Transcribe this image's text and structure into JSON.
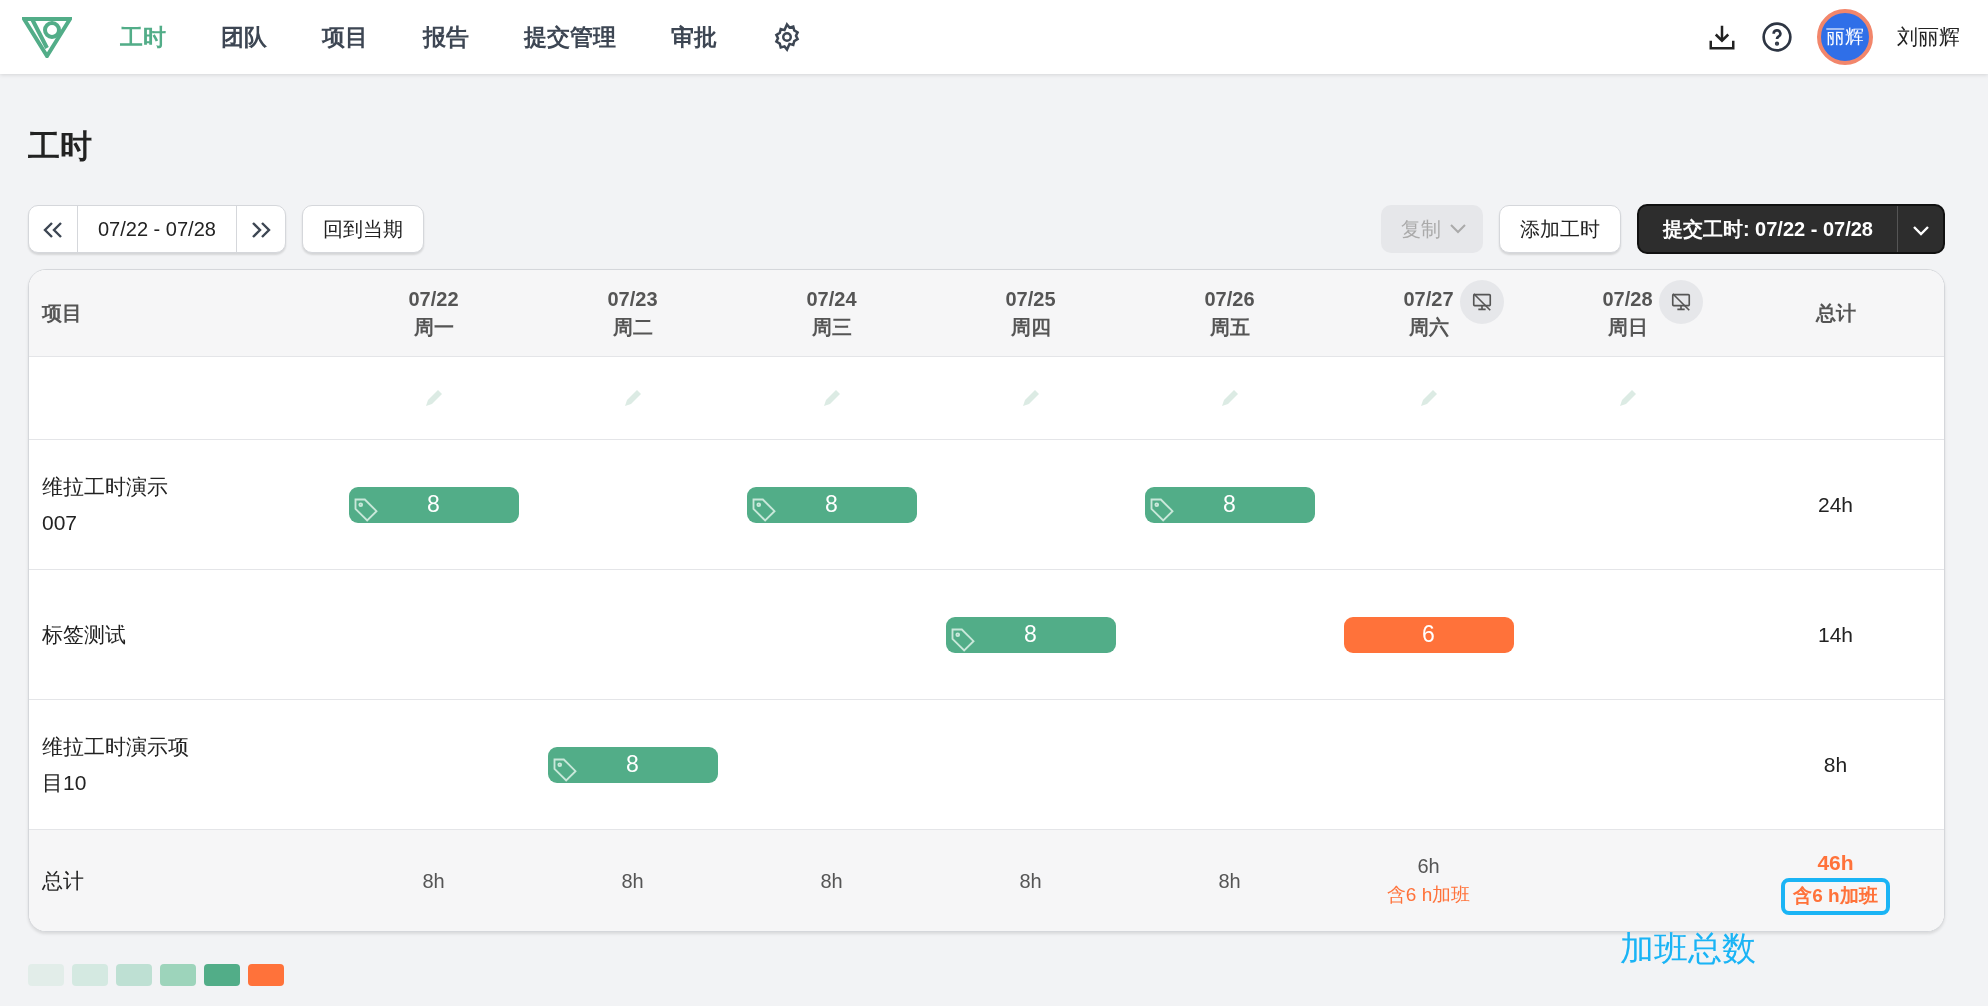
{
  "nav": {
    "items": [
      {
        "label": "工时",
        "selected": true
      },
      {
        "label": "团队",
        "selected": false
      },
      {
        "label": "项目",
        "selected": false
      },
      {
        "label": "报告",
        "selected": false
      },
      {
        "label": "提交管理",
        "selected": false
      },
      {
        "label": "审批",
        "selected": false
      }
    ],
    "user": {
      "avatar_text": "丽辉",
      "name": "刘丽辉"
    }
  },
  "page_title": "工时",
  "toolbar": {
    "range": "07/22 - 07/28",
    "current_button": "回到当期",
    "copy": {
      "label": "复制",
      "disabled": true
    },
    "add_button": "添加工时",
    "submit_button": "提交工时: 07/22 - 07/28"
  },
  "table": {
    "project_header": "项目",
    "total_header": "总计",
    "days": [
      {
        "date": "07/22",
        "weekday": "周一",
        "off_day": false
      },
      {
        "date": "07/23",
        "weekday": "周二",
        "off_day": false
      },
      {
        "date": "07/24",
        "weekday": "周三",
        "off_day": false
      },
      {
        "date": "07/25",
        "weekday": "周四",
        "off_day": false
      },
      {
        "date": "07/26",
        "weekday": "周五",
        "off_day": false
      },
      {
        "date": "07/27",
        "weekday": "周六",
        "off_day": true
      },
      {
        "date": "07/28",
        "weekday": "周日",
        "off_day": true
      }
    ],
    "rows": [
      {
        "project": "维拉工时演示007",
        "total": "24h",
        "cells": [
          {
            "hours": "8",
            "tagged": true,
            "overtime": false
          },
          null,
          {
            "hours": "8",
            "tagged": true,
            "overtime": false
          },
          null,
          {
            "hours": "8",
            "tagged": true,
            "overtime": false
          },
          null,
          null
        ]
      },
      {
        "project": "标签测试",
        "total": "14h",
        "cells": [
          null,
          null,
          null,
          {
            "hours": "8",
            "tagged": true,
            "overtime": false
          },
          null,
          {
            "hours": "6",
            "tagged": false,
            "overtime": true
          },
          null
        ]
      },
      {
        "project": "维拉工时演示项目10",
        "total": "8h",
        "cells": [
          null,
          {
            "hours": "8",
            "tagged": true,
            "overtime": false
          },
          null,
          null,
          null,
          null,
          null
        ]
      }
    ],
    "footer": {
      "label": "总计",
      "days": [
        {
          "value": "8h"
        },
        {
          "value": "8h"
        },
        {
          "value": "8h"
        },
        {
          "value": "8h"
        },
        {
          "value": "8h"
        },
        {
          "value": "6h",
          "note": "含6 h加班"
        }
      ],
      "total": {
        "value": "46h",
        "overtime": true,
        "note": "含6 h加班",
        "highlighted": true
      }
    }
  },
  "annotation": "加班总数",
  "legend": [
    {
      "color": "#e2ede9"
    },
    {
      "color": "#d4e9e1"
    },
    {
      "color": "#bee0d3"
    },
    {
      "color": "#9dd4bb"
    },
    {
      "color": "#52ad88"
    },
    {
      "color": "#ff723a"
    }
  ]
}
